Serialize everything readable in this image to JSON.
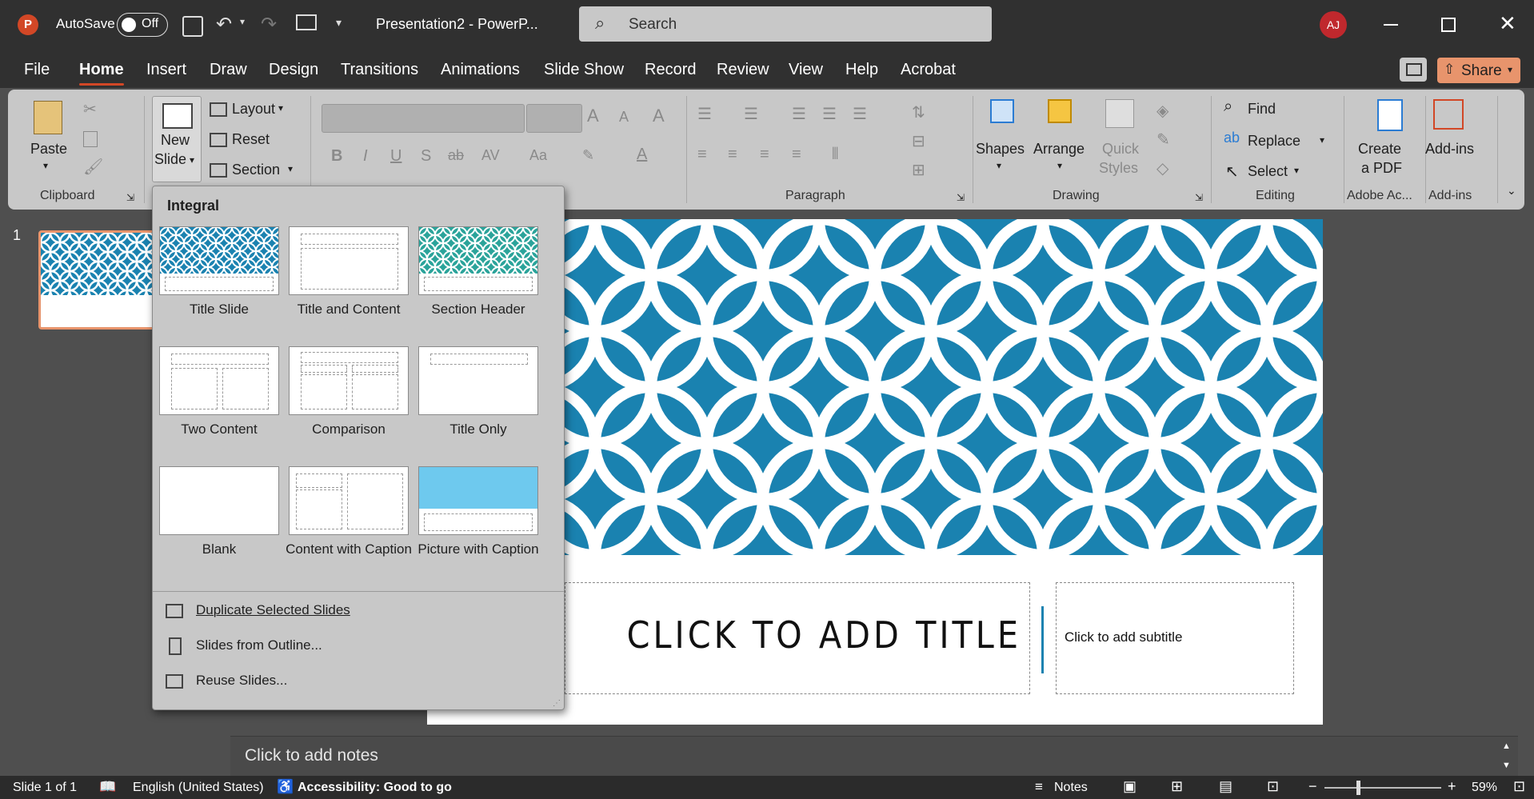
{
  "titlebar": {
    "autosave_label": "AutoSave",
    "autosave_state": "Off",
    "doc_title": "Presentation2 - PowerP...",
    "search_placeholder": "Search",
    "user_initials": "AJ"
  },
  "tabs": [
    "File",
    "Home",
    "Insert",
    "Draw",
    "Design",
    "Transitions",
    "Animations",
    "Slide Show",
    "Record",
    "Review",
    "View",
    "Help",
    "Acrobat"
  ],
  "active_tab": "Home",
  "share_label": "Share",
  "ribbon": {
    "clipboard": {
      "paste": "Paste",
      "group": "Clipboard"
    },
    "slides": {
      "new_slide_line1": "New",
      "new_slide_line2": "Slide",
      "layout": "Layout",
      "reset": "Reset",
      "section": "Section"
    },
    "paragraph": {
      "group": "Paragraph"
    },
    "drawing": {
      "shapes": "Shapes",
      "arrange": "Arrange",
      "quick_styles_line1": "Quick",
      "quick_styles_line2": "Styles",
      "group": "Drawing"
    },
    "editing": {
      "find": "Find",
      "replace": "Replace",
      "select": "Select",
      "group": "Editing"
    },
    "adobe": {
      "create_line1": "Create",
      "create_line2": "a PDF",
      "group": "Adobe Ac..."
    },
    "addins": {
      "label": "Add-ins",
      "group": "Add-ins"
    }
  },
  "thumbnail": {
    "number": "1"
  },
  "slide": {
    "title": "CLICK TO ADD TITLE",
    "subtitle": "Click to add subtitle"
  },
  "notes_placeholder": "Click to add notes",
  "status": {
    "slide_count": "Slide 1 of 1",
    "language": "English (United States)",
    "accessibility": "Accessibility: Good to go",
    "notes": "Notes",
    "zoom": "59%"
  },
  "dropdown": {
    "header": "Integral",
    "layouts": [
      "Title Slide",
      "Title and Content",
      "Section Header",
      "Two Content",
      "Comparison",
      "Title Only",
      "Blank",
      "Content with Caption",
      "Picture with Caption"
    ],
    "commands": [
      "Duplicate Selected Slides",
      "Slides from Outline...",
      "Reuse Slides..."
    ]
  },
  "colors": {
    "accent": "#d24726",
    "slide_blue": "#1a82b0",
    "teal": "#2aa39a",
    "share": "#e8946c"
  }
}
